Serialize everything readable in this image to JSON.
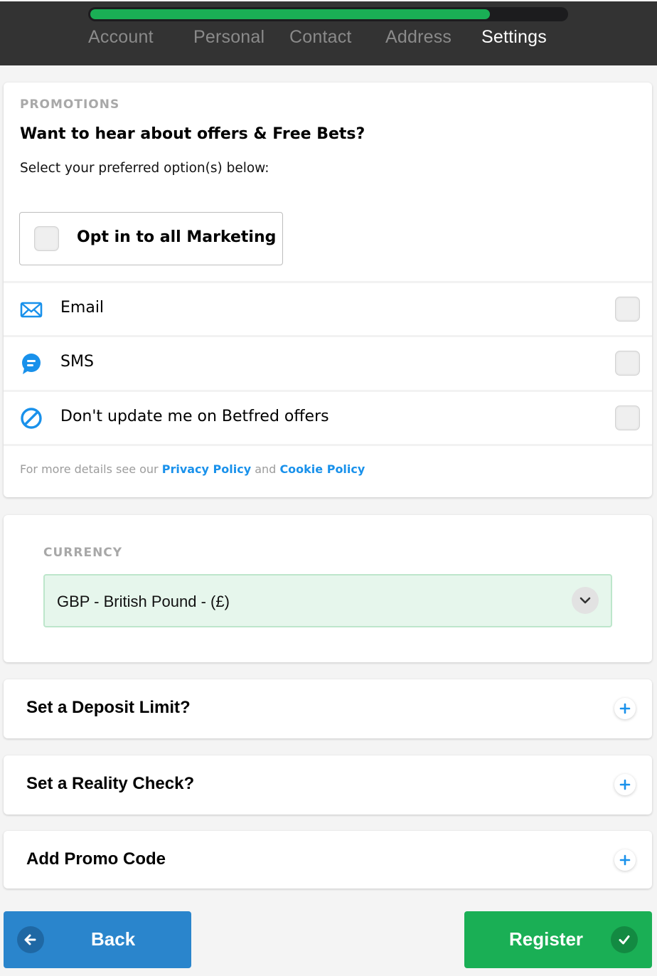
{
  "progress": {
    "percent": 84,
    "fill_color": "#1aaf55"
  },
  "steps": [
    {
      "label": "Account",
      "active": false
    },
    {
      "label": "Personal",
      "active": false
    },
    {
      "label": "Contact",
      "active": false
    },
    {
      "label": "Address",
      "active": false
    },
    {
      "label": "Settings",
      "active": true
    }
  ],
  "promotions": {
    "eyebrow": "PROMOTIONS",
    "headline": "Want to hear about offers & Free Bets?",
    "subline": "Select your preferred option(s) below:",
    "optin_label": "Opt in to all Marketing",
    "optin_checked": false,
    "options": [
      {
        "icon": "envelope-icon",
        "label": "Email",
        "checked": false
      },
      {
        "icon": "chat-bubble-icon",
        "label": "SMS",
        "checked": false
      },
      {
        "icon": "no-entry-icon",
        "label": "Don't update me on Betfred offers",
        "checked": false
      }
    ],
    "footnote_prefix": "For more details see our",
    "privacy_link": "Privacy Policy",
    "footnote_and": "and",
    "cookie_link": "Cookie Policy"
  },
  "currency": {
    "label": "CURRENCY",
    "selected": "GBP - British Pound - (£)"
  },
  "accordions": [
    {
      "title": "Set a Deposit Limit?",
      "icon": "plus-icon"
    },
    {
      "title": "Set a Reality Check?",
      "icon": "plus-icon"
    },
    {
      "title": "Add Promo Code",
      "icon": "plus-icon"
    }
  ],
  "buttons": {
    "back_label": "Back",
    "register_label": "Register"
  },
  "colors": {
    "accent_blue": "#1991eb",
    "back_blue": "#2a85cc",
    "register_green": "#1aaf55",
    "header_bg": "#333333"
  }
}
